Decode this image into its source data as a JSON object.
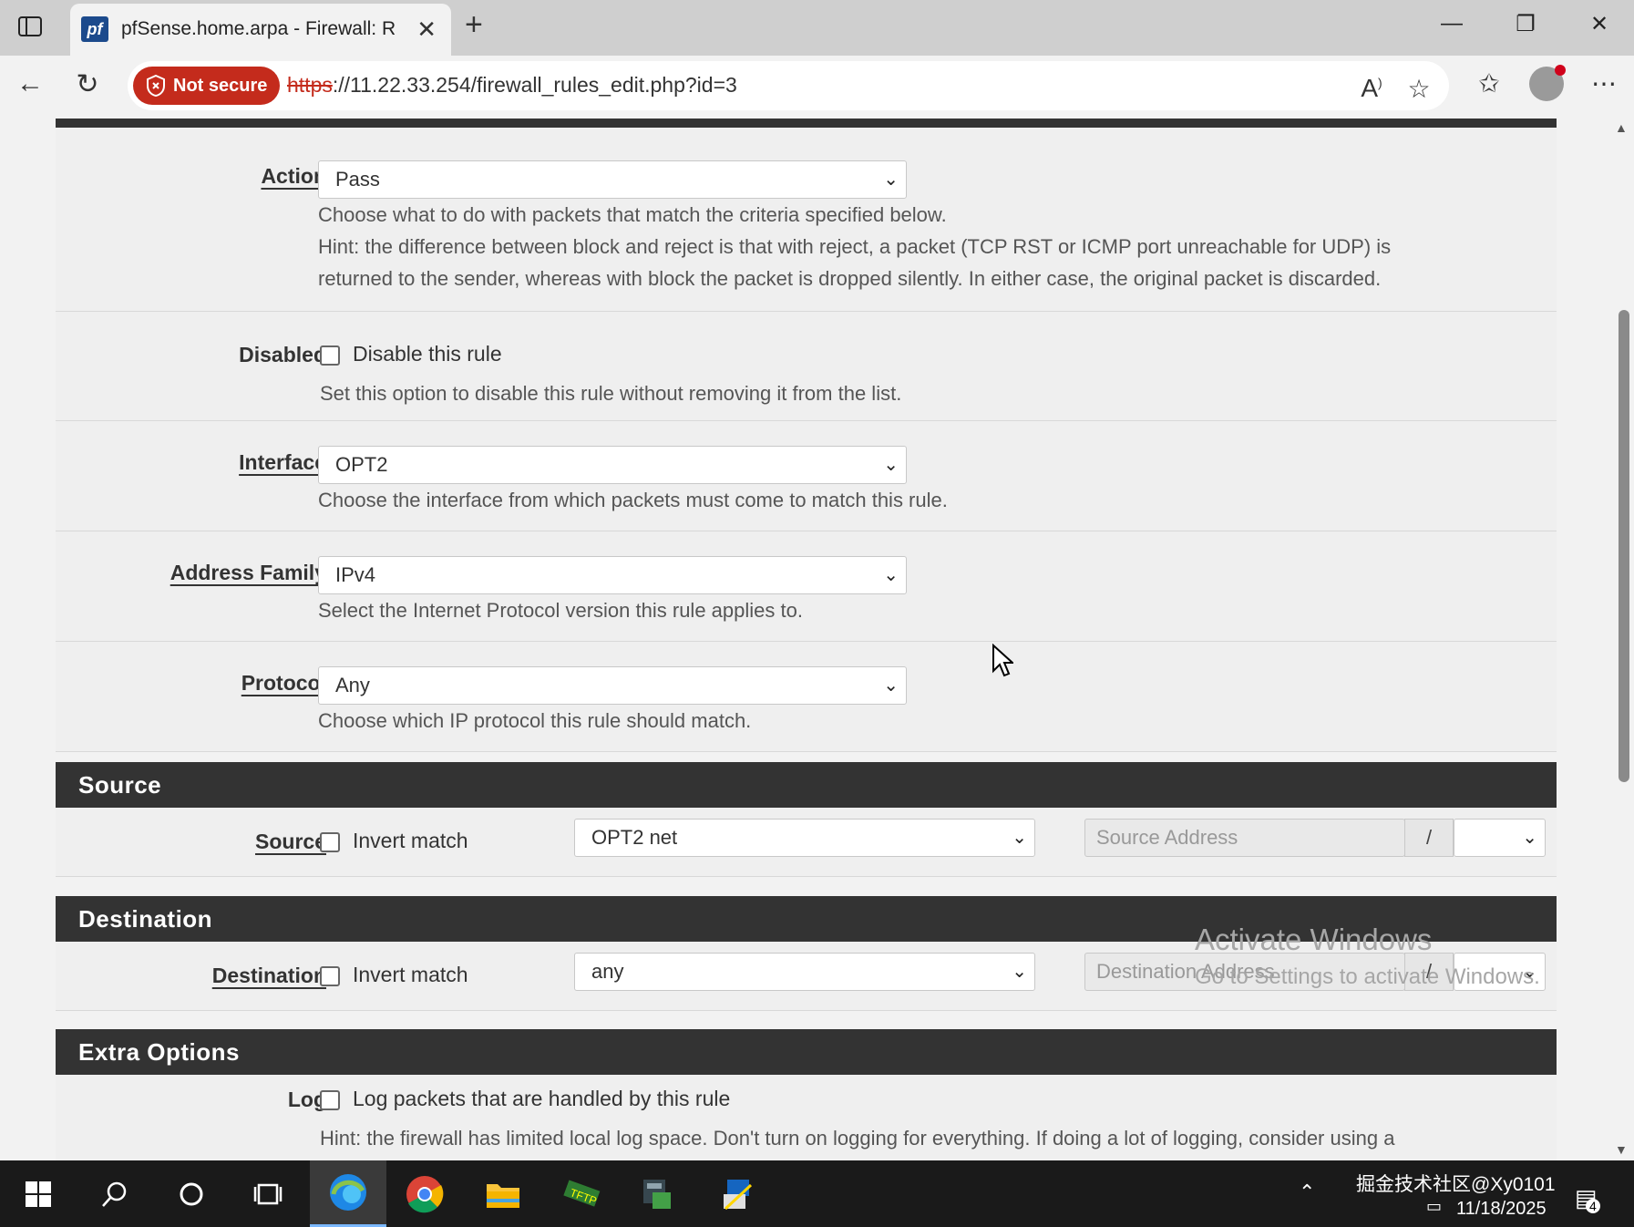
{
  "browser": {
    "tab_title": "pfSense.home.arpa - Firewall: Rul",
    "tab_favicon_text": "pf",
    "security_label": "Not secure",
    "url_protocol": "https",
    "url_rest": "://11.22.33.254/firewall_rules_edit.php?id=3",
    "window_controls": [
      "minimize",
      "restore",
      "close"
    ]
  },
  "form": {
    "action": {
      "label": "Action",
      "value": "Pass",
      "help1": "Choose what to do with packets that match the criteria specified below.",
      "help2": "Hint: the difference between block and reject is that with reject, a packet (TCP RST or ICMP port unreachable for UDP) is",
      "help3": "returned to the sender, whereas with block the packet is dropped silently. In either case, the original packet is discarded."
    },
    "disabled": {
      "label": "Disabled",
      "checkbox_label": "Disable this rule",
      "checked": false,
      "help": "Set this option to disable this rule without removing it from the list."
    },
    "interface": {
      "label": "Interface",
      "value": "OPT2",
      "help": "Choose the interface from which packets must come to match this rule."
    },
    "address_family": {
      "label": "Address Family",
      "value": "IPv4",
      "help": "Select the Internet Protocol version this rule applies to."
    },
    "protocol": {
      "label": "Protocol",
      "value": "Any",
      "help": "Choose which IP protocol this rule should match."
    }
  },
  "source_section": {
    "heading": "Source",
    "label": "Source",
    "invert_label": "Invert match",
    "type_value": "OPT2 net",
    "address_placeholder": "Source Address",
    "slash": "/"
  },
  "destination_section": {
    "heading": "Destination",
    "label": "Destination",
    "invert_label": "Invert match",
    "type_value": "any",
    "address_placeholder": "Destination Address",
    "slash": "/"
  },
  "extra_section": {
    "heading": "Extra Options",
    "log_label": "Log",
    "log_checkbox_label": "Log packets that are handled by this rule",
    "log_hint": "Hint: the firewall has limited local log space. Don't turn on logging for everything. If doing a lot of logging, consider using a"
  },
  "watermark": {
    "line1": "Activate Windows",
    "line2": "Go to Settings to activate Windows."
  },
  "taskbar": {
    "tray_text": "掘金技术社区@Xy0101",
    "date": "11/18/2025",
    "notification_count": "4"
  },
  "colors": {
    "section_header": "#333333",
    "not_secure": "#c42b1c",
    "taskbar": "#1a1a1a"
  }
}
